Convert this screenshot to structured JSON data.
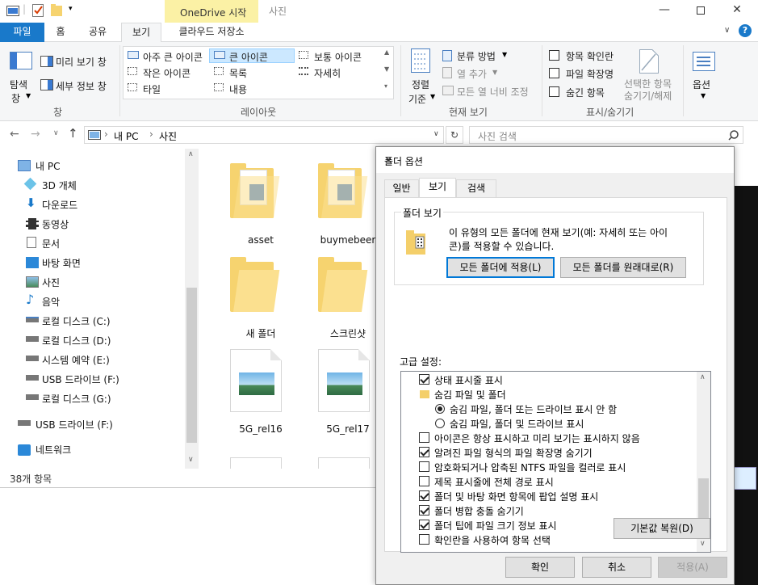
{
  "explorer": {
    "title": "사진",
    "onedrive_tab": "OneDrive 시작",
    "tabs": {
      "file": "파일",
      "home": "홈",
      "share": "공유",
      "view": "보기",
      "cloud": "클라우드 저장소"
    },
    "ribbon": {
      "navpane_label": "탐색\n창",
      "nav_a": "탐색",
      "nav_b": "창",
      "preview_pane": "미리 보기 창",
      "details_pane": "세부 정보 창",
      "pane_group": "창",
      "layout_items": [
        "아주 큰 아이콘",
        "큰 아이콘",
        "보통 아이콘",
        "작은 아이콘",
        "목록",
        "자세히",
        "타일",
        "내용"
      ],
      "layout_group": "레이아웃",
      "sort_a": "정렬",
      "sort_b": "기준",
      "group_by": "분류 방법",
      "add_columns": "열 추가",
      "fit_columns": "모든 열 너비 조정",
      "current_view_group": "현재 보기",
      "item_checkboxes": "항목 확인란",
      "file_extensions": "파일 확장명",
      "hidden_items": "숨긴 항목",
      "hide_selected_a": "선택한 항목",
      "hide_selected_b": "숨기기/해제",
      "show_hide_group": "표시/숨기기",
      "options": "옵션"
    },
    "address": {
      "pc": "내 PC",
      "folder": "사진",
      "search_placeholder": "사진 검색"
    },
    "nav": [
      "내 PC",
      "3D 개체",
      "다운로드",
      "동영상",
      "문서",
      "바탕 화면",
      "사진",
      "음악",
      "로컬 디스크 (C:)",
      "로컬 디스크 (D:)",
      "시스템 예약 (E:)",
      "USB 드라이브 (F:)",
      "로컬 디스크 (G:)",
      "USB 드라이브 (F:)",
      "네트워크"
    ],
    "files": [
      "asset",
      "buymebeer",
      "새 폴더",
      "스크린샷",
      "5G_rel16",
      "5G_rel17"
    ],
    "status": "38개 항목"
  },
  "dialog": {
    "title": "폴더 옵션",
    "tabs": [
      "일반",
      "보기",
      "검색"
    ],
    "folder_views": {
      "legend": "폴더 보기",
      "desc_1": "이 유형의 모든 폴더에 현재 보기(예: 자세히 또는 아이",
      "desc_2": "콘)를 적용할 수 있습니다.",
      "apply_btn": "모든 폴더에 적용(L)",
      "reset_btn": "모든 폴더를 원래대로(R)"
    },
    "advanced_label": "고급 설정:",
    "advanced": [
      {
        "label": "상태 표시줄 표시",
        "kind": "check",
        "checked": true
      },
      {
        "label": "숨김 파일 및 폴더",
        "kind": "folder"
      },
      {
        "label": "숨김 파일, 폴더 또는 드라이브 표시 안 함",
        "kind": "radio",
        "checked": true
      },
      {
        "label": "숨김 파일, 폴더 및 드라이브 표시",
        "kind": "radio",
        "checked": false
      },
      {
        "label": "아이콘은 항상 표시하고 미리 보기는 표시하지 않음",
        "kind": "check",
        "checked": false
      },
      {
        "label": "알려진 파일 형식의 파일 확장명 숨기기",
        "kind": "check",
        "checked": true
      },
      {
        "label": "암호화되거나 압축된 NTFS 파일을 컬러로 표시",
        "kind": "check",
        "checked": false
      },
      {
        "label": "제목 표시줄에 전체 경로 표시",
        "kind": "check",
        "checked": false
      },
      {
        "label": "폴더 및 바탕 화면 항목에 팝업 설명 표시",
        "kind": "check",
        "checked": true
      },
      {
        "label": "폴더 병합 충돌 숨기기",
        "kind": "check",
        "checked": true
      },
      {
        "label": "폴더 팁에 파일 크기 정보 표시",
        "kind": "check",
        "checked": true
      },
      {
        "label": "확인란을 사용하여 항목 선택",
        "kind": "check",
        "checked": false
      }
    ],
    "restore_btn": "기본값 복원(D)",
    "ok_btn": "확인",
    "cancel_btn": "취소",
    "apply_btn": "적용(A)"
  }
}
